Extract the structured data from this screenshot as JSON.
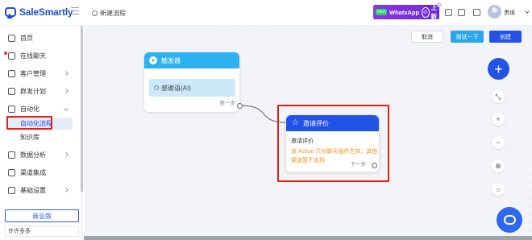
{
  "brand": {
    "name": "SaleSmartly",
    "color": "#1d4fd8"
  },
  "header": {
    "breadcrumb": "新建流程",
    "whatsapp_badge": {
      "new_tag": "New",
      "label": "WhatsApp",
      "action": "上新"
    },
    "user_name": "贵续"
  },
  "sidebar": {
    "items": [
      {
        "label": "首页",
        "icon": "home-icon"
      },
      {
        "label": "在线聊天",
        "icon": "chat-icon",
        "has_dot": true
      },
      {
        "label": "客户管理",
        "icon": "users-icon"
      },
      {
        "label": "群发计划",
        "icon": "send-icon"
      },
      {
        "label": "自动化",
        "icon": "automation-icon",
        "expanded": true
      },
      {
        "label": "数据分析",
        "icon": "chart-icon"
      },
      {
        "label": "渠道集成",
        "icon": "integration-icon"
      },
      {
        "label": "基础设置",
        "icon": "settings-icon"
      }
    ],
    "sub_items": [
      {
        "label": "自动化流程",
        "active": true
      },
      {
        "label": "知识库",
        "active": false
      }
    ],
    "plan_label": "商业版",
    "workspace": "许许多多"
  },
  "toolbar": {
    "cancel_label": "取消",
    "test_label": "测试一下",
    "create_label": "创建"
  },
  "flow": {
    "trigger_node": {
      "title": "触发器",
      "trigger_item": "感谢语(AI)",
      "step_label": "第一步"
    },
    "invite_node": {
      "title": "邀请评价",
      "subtitle": "邀请评价",
      "warning": "该 Action 只对聊天插件生效，其他渠道暂不支持",
      "step_label": "下一步"
    }
  },
  "colors": {
    "trigger": "#2cb1f1",
    "action": "#2352e6",
    "warning": "#f29418",
    "highlight": "#e0211c"
  }
}
